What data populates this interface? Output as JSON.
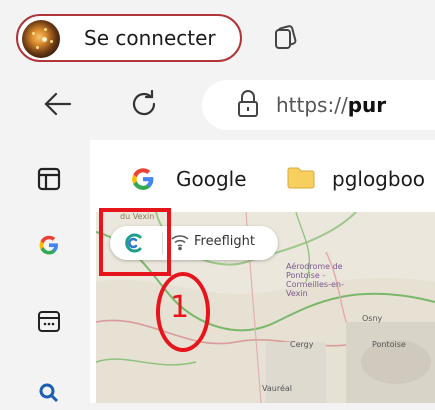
{
  "profile": {
    "label": "Se connecter",
    "avatar_icon": "profile-avatar-icon"
  },
  "toolbar": {
    "tabs_icon": "tab-actions-icon",
    "back_icon": "back-arrow-icon",
    "reload_icon": "reload-icon"
  },
  "address": {
    "lock_icon": "site-info-lock-icon",
    "url_prefix": "https://",
    "url_bold": "pur"
  },
  "favorites": [
    {
      "label": "Google",
      "icon": "google-icon"
    },
    {
      "label": "pglogboo",
      "icon": "folder-icon"
    }
  ],
  "sidebar": {
    "items": [
      {
        "icon": "sidebar-panel-icon"
      },
      {
        "icon": "google-icon"
      },
      {
        "icon": "calendar-icon"
      },
      {
        "icon": "search-icon"
      }
    ]
  },
  "map": {
    "chip_label": "Freeflight",
    "labels": [
      "du Vexin",
      "Aérodrome de Pontoise - Cormeilles-en-Vexin",
      "Osny",
      "Cergy",
      "Pontoise",
      "Vauréal"
    ]
  },
  "annotations": {
    "number": "1",
    "color": "#e8141c"
  }
}
